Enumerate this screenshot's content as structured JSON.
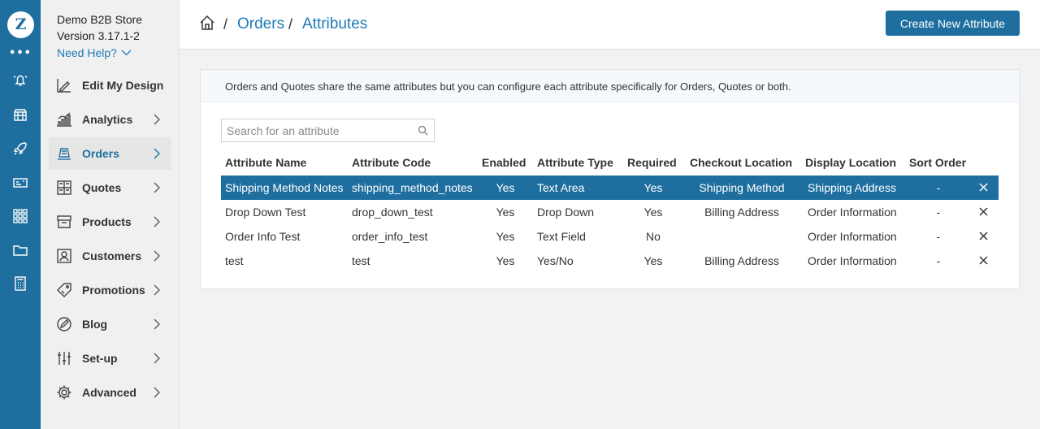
{
  "app": {
    "logo_glyph": "Z",
    "dots": "•••"
  },
  "store": {
    "name": "Demo B2B Store",
    "version": "Version 3.17.1-2",
    "help_label": "Need Help?"
  },
  "rail_icons": [
    "bell-icon",
    "store-icon",
    "rocket-icon",
    "money-icon",
    "apps-grid-icon",
    "folder-icon",
    "calculator-icon"
  ],
  "nav": {
    "items": [
      {
        "label": "Edit My Design",
        "icon": "design-icon",
        "has_chevron": false
      },
      {
        "label": "Analytics",
        "icon": "chart-icon",
        "has_chevron": true
      },
      {
        "label": "Orders",
        "icon": "orders-icon",
        "has_chevron": true,
        "active": true
      },
      {
        "label": "Quotes",
        "icon": "quotes-icon",
        "has_chevron": true
      },
      {
        "label": "Products",
        "icon": "box-icon",
        "has_chevron": true
      },
      {
        "label": "Customers",
        "icon": "customer-icon",
        "has_chevron": true
      },
      {
        "label": "Promotions",
        "icon": "tag-icon",
        "has_chevron": true
      },
      {
        "label": "Blog",
        "icon": "pen-icon",
        "has_chevron": true
      },
      {
        "label": "Set-up",
        "icon": "sliders-icon",
        "has_chevron": true
      },
      {
        "label": "Advanced",
        "icon": "gear-icon",
        "has_chevron": true
      }
    ]
  },
  "header": {
    "breadcrumb": [
      {
        "label": "Orders"
      },
      {
        "label": "Attributes"
      }
    ],
    "separator": "/",
    "create_button": "Create New Attribute"
  },
  "info_text": "Orders and Quotes share the same attributes but you can configure each attribute specifically for Orders, Quotes or both.",
  "search": {
    "placeholder": "Search for an attribute",
    "value": ""
  },
  "table": {
    "columns": [
      "Attribute Name",
      "Attribute Code",
      "Enabled",
      "Attribute Type",
      "Required",
      "Checkout Location",
      "Display Location",
      "Sort Order"
    ],
    "rows": [
      {
        "name": "Shipping Method Notes",
        "code": "shipping_method_notes",
        "enabled": "Yes",
        "type": "Text Area",
        "required": "Yes",
        "checkout": "Shipping Method",
        "display": "Shipping Address",
        "sort": "-",
        "selected": true
      },
      {
        "name": "Drop Down Test",
        "code": "drop_down_test",
        "enabled": "Yes",
        "type": "Drop Down",
        "required": "Yes",
        "checkout": "Billing Address",
        "display": "Order Information",
        "sort": "-"
      },
      {
        "name": "Order Info Test",
        "code": "order_info_test",
        "enabled": "Yes",
        "type": "Text Field",
        "required": "No",
        "checkout": "",
        "display": "Order Information",
        "sort": "-"
      },
      {
        "name": "test",
        "code": "test",
        "enabled": "Yes",
        "type": "Yes/No",
        "required": "Yes",
        "checkout": "Billing Address",
        "display": "Order Information",
        "sort": "-"
      }
    ]
  },
  "colors": {
    "brand": "#1e6f9f",
    "link": "#1e7ab8",
    "selected_row": "#1e6f9f"
  }
}
